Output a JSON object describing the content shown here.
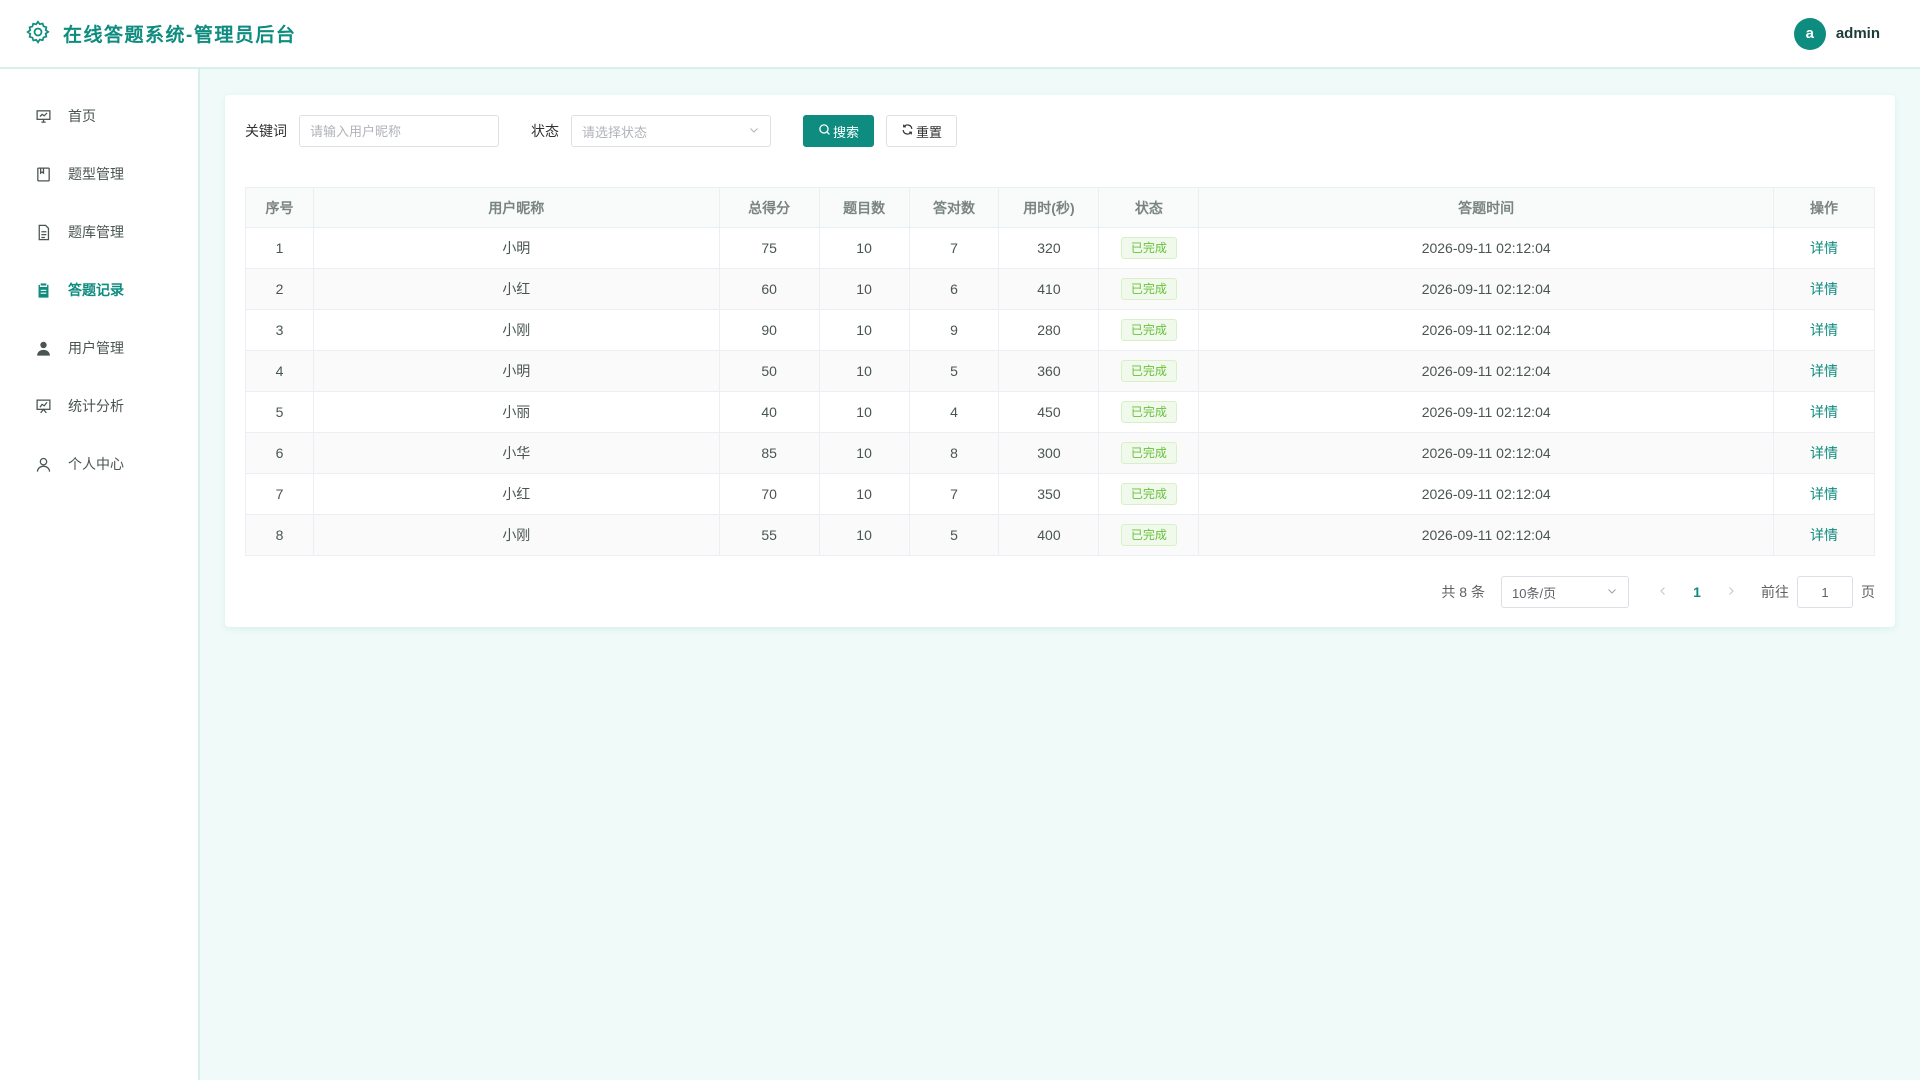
{
  "header": {
    "title": "在线答题系统-管理员后台",
    "avatar_letter": "a",
    "username": "admin",
    "accent": "#0e8c7f"
  },
  "sidebar": {
    "items": [
      {
        "label": "首页",
        "icon": "monitor-icon"
      },
      {
        "label": "题型管理",
        "icon": "book-icon"
      },
      {
        "label": "题库管理",
        "icon": "document-icon"
      },
      {
        "label": "答题记录",
        "icon": "clipboard-icon",
        "active": true
      },
      {
        "label": "用户管理",
        "icon": "user-icon"
      },
      {
        "label": "统计分析",
        "icon": "chart-board-icon"
      },
      {
        "label": "个人中心",
        "icon": "person-outline-icon"
      }
    ]
  },
  "filters": {
    "keyword_label": "关键词",
    "keyword_placeholder": "请输入用户昵称",
    "status_label": "状态",
    "status_placeholder": "请选择状态",
    "search_label": "搜索",
    "reset_label": "重置"
  },
  "table": {
    "headers": [
      "序号",
      "用户昵称",
      "总得分",
      "题目数",
      "答对数",
      "用时(秒)",
      "状态",
      "答题时间",
      "操作"
    ],
    "rows": [
      {
        "no": "1",
        "name": "小明",
        "score": "75",
        "total": "10",
        "correct": "7",
        "time": "320",
        "status": "已完成",
        "date": "2026-09-11 02:12:04",
        "action": "详情"
      },
      {
        "no": "2",
        "name": "小红",
        "score": "60",
        "total": "10",
        "correct": "6",
        "time": "410",
        "status": "已完成",
        "date": "2026-09-11 02:12:04",
        "action": "详情"
      },
      {
        "no": "3",
        "name": "小刚",
        "score": "90",
        "total": "10",
        "correct": "9",
        "time": "280",
        "status": "已完成",
        "date": "2026-09-11 02:12:04",
        "action": "详情"
      },
      {
        "no": "4",
        "name": "小明",
        "score": "50",
        "total": "10",
        "correct": "5",
        "time": "360",
        "status": "已完成",
        "date": "2026-09-11 02:12:04",
        "action": "详情"
      },
      {
        "no": "5",
        "name": "小丽",
        "score": "40",
        "total": "10",
        "correct": "4",
        "time": "450",
        "status": "已完成",
        "date": "2026-09-11 02:12:04",
        "action": "详情"
      },
      {
        "no": "6",
        "name": "小华",
        "score": "85",
        "total": "10",
        "correct": "8",
        "time": "300",
        "status": "已完成",
        "date": "2026-09-11 02:12:04",
        "action": "详情"
      },
      {
        "no": "7",
        "name": "小红",
        "score": "70",
        "total": "10",
        "correct": "7",
        "time": "350",
        "status": "已完成",
        "date": "2026-09-11 02:12:04",
        "action": "详情"
      },
      {
        "no": "8",
        "name": "小刚",
        "score": "55",
        "total": "10",
        "correct": "5",
        "time": "400",
        "status": "已完成",
        "date": "2026-09-11 02:12:04",
        "action": "详情"
      }
    ]
  },
  "pagination": {
    "total_text": "共 8 条",
    "page_size": "10条/页",
    "current_page": "1",
    "goto_label": "前往",
    "goto_value": "1",
    "page_suffix": "页"
  }
}
